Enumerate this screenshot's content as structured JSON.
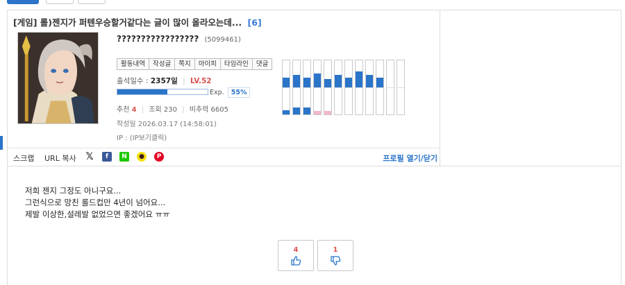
{
  "post": {
    "category": "[게임]",
    "title": "롤)젠지가 퍼텐우승할거같다는 글이 많이 올라오는데...",
    "comment_count": "[6]"
  },
  "author": {
    "nickname": "?????????????????",
    "uid": "(5099461)",
    "menu": [
      "활동내역",
      "작성글",
      "쪽지",
      "마이피",
      "타임라인",
      "댓글"
    ],
    "attendance_label": "출석일수 :",
    "attendance_value": "2357일",
    "level": "LV.52",
    "exp_label": "Exp.",
    "exp_percent_text": "55%",
    "exp_fraction": 0.55,
    "recommend_label": "추천",
    "recommend_value": "4",
    "views_label": "조회",
    "views_value": "230",
    "ratio_label": "비추력",
    "ratio_value": "6605",
    "written_label": "작성일",
    "written_value": "2026.03.17 (14:58:01)",
    "ip_label": "IP :",
    "ip_value": "(IP보기클릭)"
  },
  "activity_graph": {
    "top_levels": [
      0.35,
      0.45,
      0.35,
      0.5,
      0.3,
      0.45,
      0.35,
      0.6,
      0.45,
      0.35,
      0.0,
      0.0
    ],
    "bottom_levels": [
      0.15,
      0.25,
      0.25,
      0.12,
      0.12,
      0,
      0,
      0,
      0,
      0,
      0,
      0
    ],
    "bottom_colors": [
      "#2a74c9",
      "#2a74c9",
      "#2a74c9",
      "#f3b8c8",
      "#f3b8c8",
      "#2a74c9",
      "#2a74c9",
      "#2a74c9",
      "#2a74c9",
      "#2a74c9",
      "#2a74c9",
      "#2a74c9"
    ]
  },
  "share": {
    "scrap": "스크랩",
    "url_copy": "URL 복사",
    "icons": [
      "x-icon",
      "facebook-icon",
      "naver-icon",
      "kakao-icon",
      "pinterest-icon"
    ],
    "profile_toggle": "프로필 열기/닫기"
  },
  "content": {
    "lines": [
      "저희 젠지 그정도 아니구요...",
      "그런식으로 망친 롤드컵만 4년이 넘어요...",
      "제발 이상한,설레발 없었으면 좋겠어요 ㅠㅠ"
    ]
  },
  "votes": {
    "up": "4",
    "down": "1"
  },
  "colors": {
    "accent": "#2a74c9",
    "highlight": "#d9534f"
  }
}
